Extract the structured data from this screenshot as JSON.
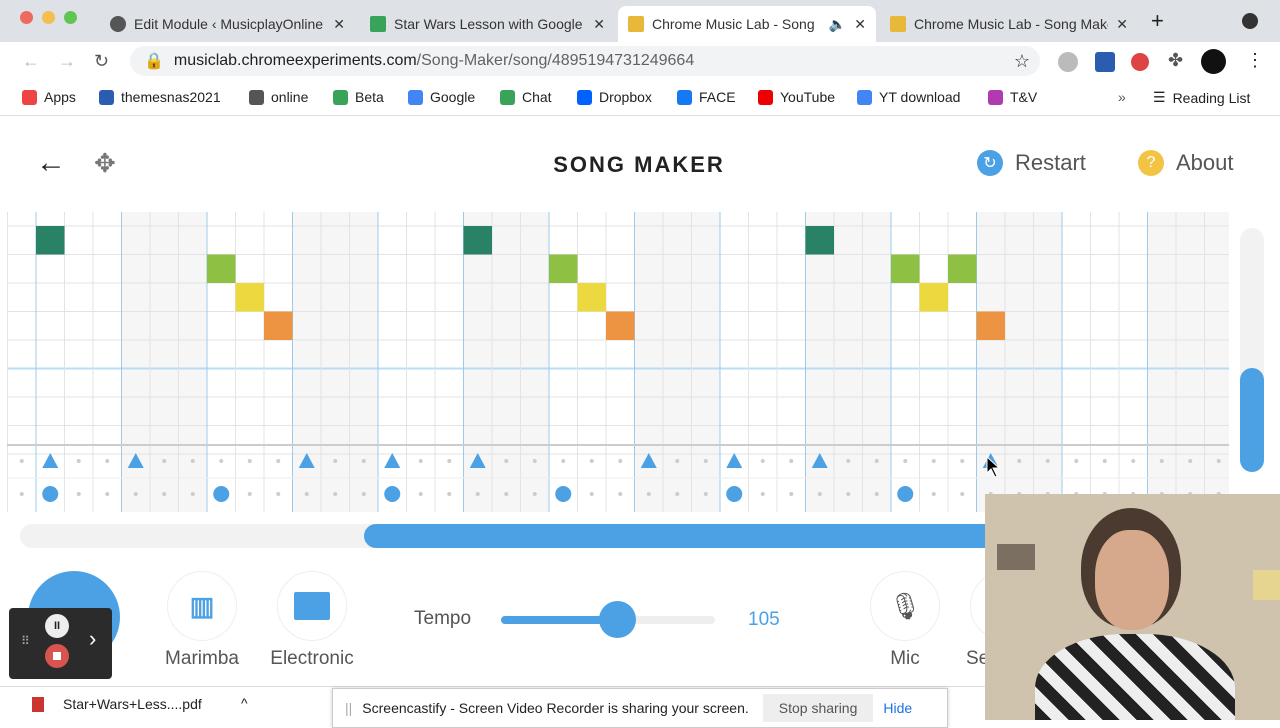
{
  "browser": {
    "tabs": [
      {
        "title": "Edit Module ‹ MusicplayOnline",
        "icon": "globe-icon",
        "active": false
      },
      {
        "title": "Star Wars Lesson with Google",
        "icon": "music-note-icon",
        "active": false
      },
      {
        "title": "Chrome Music Lab - Song",
        "icon": "music-lab-icon",
        "active": true,
        "audio": true
      },
      {
        "title": "Chrome Music Lab - Song Maker",
        "icon": "music-lab-icon",
        "active": false
      }
    ],
    "url_domain": "musiclab.chromeexperiments.com",
    "url_path": "/Song-Maker/song/4895194731249664",
    "bookmarks": [
      "Apps",
      "themesnas2021",
      "online",
      "Beta",
      "Google",
      "Chat",
      "Dropbox",
      "FACE",
      "YouTube",
      "YT download",
      "T&V"
    ],
    "more": "»",
    "reading_list": "Reading List"
  },
  "app": {
    "title": "SONG MAKER",
    "restart": "Restart",
    "about": "About",
    "restart_icon": "?",
    "about_icon": "?",
    "colors": {
      "accent": "#4ca1e4",
      "teal": "#2a8266",
      "lime": "#8dc043",
      "yellow": "#ecd940",
      "orange": "#ec9441"
    },
    "grid": {
      "columns": 43,
      "beats_per_bar": 3,
      "notes": [
        {
          "col": 0,
          "row": 0,
          "color": "teal"
        },
        {
          "col": 6,
          "row": 1,
          "color": "lime"
        },
        {
          "col": 7,
          "row": 2,
          "color": "yellow"
        },
        {
          "col": 8,
          "row": 3,
          "color": "orange"
        },
        {
          "col": 15,
          "row": 0,
          "color": "teal"
        },
        {
          "col": 18,
          "row": 1,
          "color": "lime"
        },
        {
          "col": 19,
          "row": 2,
          "color": "yellow"
        },
        {
          "col": 20,
          "row": 3,
          "color": "orange"
        },
        {
          "col": 27,
          "row": 0,
          "color": "teal"
        },
        {
          "col": 30,
          "row": 1,
          "color": "lime"
        },
        {
          "col": 31,
          "row": 2,
          "color": "yellow"
        },
        {
          "col": 32,
          "row": 1,
          "color": "lime"
        },
        {
          "col": 33,
          "row": 3,
          "color": "orange"
        }
      ],
      "triangles": [
        0,
        3,
        9,
        12,
        15,
        21,
        24,
        27,
        33
      ],
      "circles": [
        0,
        6,
        12,
        18,
        24,
        30
      ]
    },
    "instruments": {
      "melody": "Marimba",
      "rhythm": "Electronic"
    },
    "tempo_label": "Tempo",
    "tempo": 105,
    "tempo_range": [
      50,
      160
    ],
    "mic": "Mic",
    "settings": "Se"
  },
  "download": {
    "file": "Star+Wars+Less....pdf"
  },
  "share_bar": {
    "message": "Screencastify - Screen Video Recorder is sharing your screen.",
    "stop": "Stop sharing",
    "hide": "Hide"
  }
}
